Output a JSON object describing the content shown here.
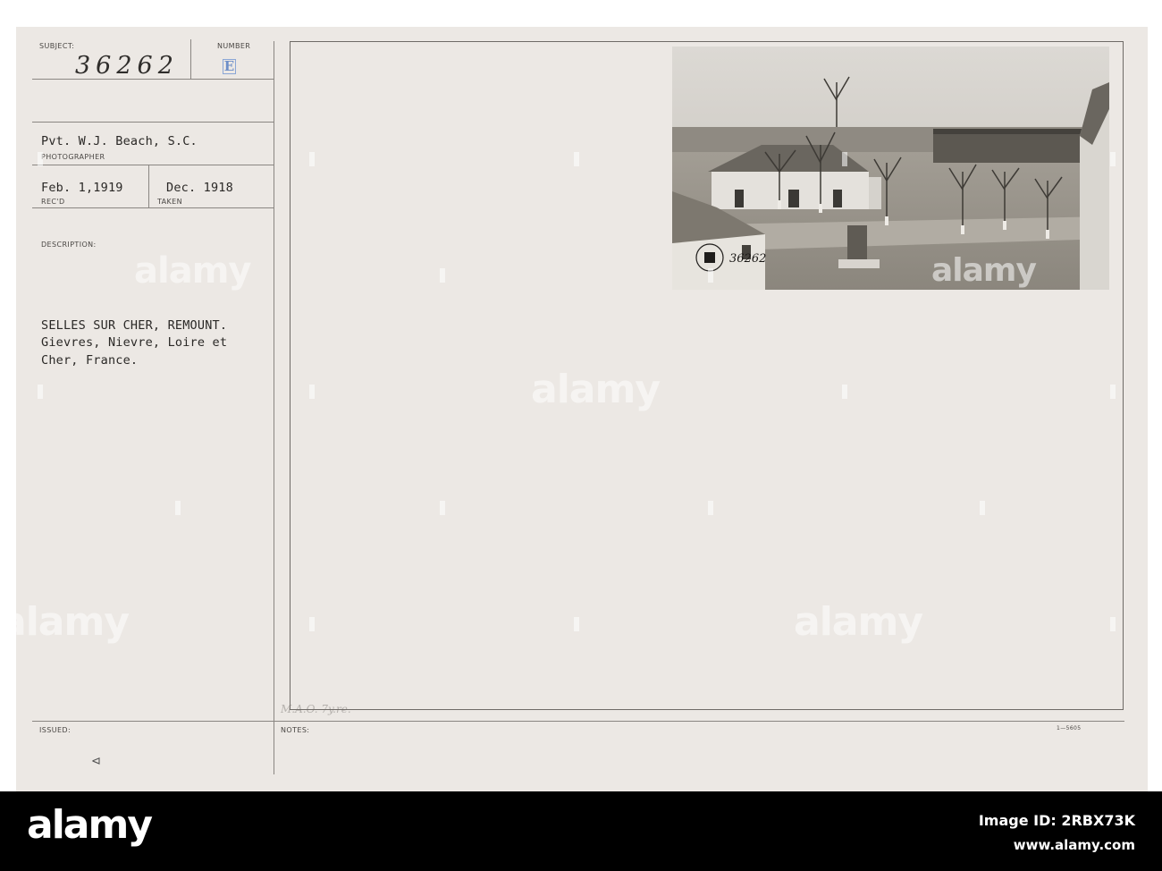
{
  "card": {
    "subject_label": "SUBJECT:",
    "number_label": "NUMBER",
    "subject_number": "36262",
    "number_letter": "E",
    "photographer_name": "Pvt. W.J. Beach, S.C.",
    "photographer_label": "PHOTOGRAPHER",
    "received_date": "Feb. 1,1919",
    "received_label": "REC'D",
    "taken_date": "Dec. 1918",
    "taken_label": "TAKEN",
    "description_label": "DESCRIPTION:",
    "description_lines": [
      "SELLES SUR CHER, REMOUNT.",
      "Gievres, Nievre, Loire et",
      "Cher, France."
    ],
    "issued_label": "ISSUED:",
    "notes_label": "NOTES:",
    "pencil_note": "M.A.O. 7y.re.",
    "form_code": "1—5605",
    "corner_mark": "⊲"
  },
  "photo": {
    "overlay_number": "36262"
  },
  "watermark": {
    "text": "alamy"
  },
  "footer": {
    "logo": "alamy",
    "image_id": "Image ID: 2RBX73K",
    "site": "www.alamy.com"
  }
}
